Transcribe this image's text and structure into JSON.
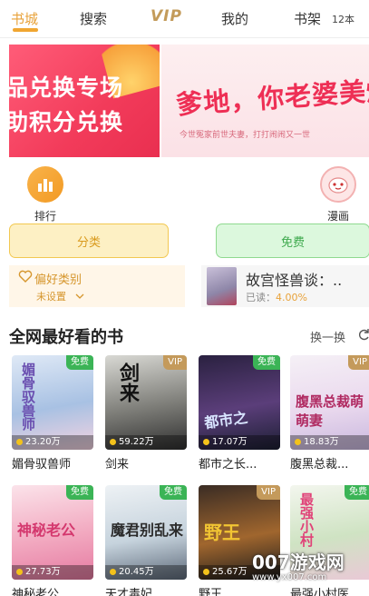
{
  "tabs": [
    {
      "label": "书城"
    },
    {
      "label": "搜索"
    },
    {
      "label": "VIP"
    },
    {
      "label": "我的"
    },
    {
      "label": "书架"
    }
  ],
  "shelf_count": "12本",
  "banner": {
    "left_line1": "品兑换专场",
    "left_line2": "助积分兑换",
    "right_headline": "爹地，你老婆美爆了",
    "right_sub": "今世冤家前世夫妻，打打闹闹又一世"
  },
  "quick_icons": [
    {
      "label": "排行",
      "icon": "bar-chart-icon"
    },
    {
      "label": "漫画",
      "icon": "comic-face-icon"
    }
  ],
  "category_buttons": {
    "left": "分类",
    "right": "免费"
  },
  "preference": {
    "title": "偏好类别",
    "value": "未设置"
  },
  "recent_reading": {
    "title": "故宫怪兽谈：..",
    "progress_label": "已读：",
    "progress": "4.00%"
  },
  "section": {
    "title": "全网最好看的书",
    "swap_label": "换一换"
  },
  "books": [
    {
      "name": "媚骨驭兽师",
      "views": "23.20万",
      "badge": "免费",
      "cover_text": "媚骨驭兽师",
      "colors": [
        "#dfe9f6",
        "#a8c1e3",
        "#f3d3e0"
      ]
    },
    {
      "name": "剑来",
      "views": "59.22万",
      "badge": "VIP",
      "cover_text": "剑来",
      "colors": [
        "#d9d9d4",
        "#7d7d78",
        "#2f2f2f"
      ]
    },
    {
      "name": "都市之长...",
      "views": "17.07万",
      "badge": "免费",
      "cover_text": "都市之",
      "colors": [
        "#2a2140",
        "#5b3e7a",
        "#1c1f33"
      ]
    },
    {
      "name": "腹黑总裁...",
      "views": "18.83万",
      "badge": "VIP",
      "cover_text": "腹黑总裁萌萌妻",
      "colors": [
        "#f5f0f6",
        "#ead9ee",
        "#c9b8de"
      ]
    },
    {
      "name": "神秘老公...",
      "views": "27.73万",
      "badge": "免费",
      "cover_text": "神秘老公",
      "colors": [
        "#fbe3ea",
        "#f2a9c0",
        "#e57aa1"
      ]
    },
    {
      "name": "天才毒妃...",
      "views": "20.45万",
      "badge": "免费",
      "cover_text": "魔君别乱来",
      "colors": [
        "#eef2f5",
        "#c6d3dd",
        "#5e6a7a"
      ]
    },
    {
      "name": "野王",
      "views": "25.67万",
      "badge": "VIP",
      "cover_text": "野王",
      "colors": [
        "#3a2c24",
        "#a0662e",
        "#1b1b1b"
      ]
    },
    {
      "name": "最强小村医",
      "views": "",
      "badge": "免费",
      "cover_text": "最强小村",
      "colors": [
        "#f3f6ee",
        "#cfe3c3",
        "#e9c9d6"
      ]
    }
  ],
  "watermark": {
    "line1": "007游戏网",
    "line2": "www.yx007.com"
  },
  "colors": {
    "accent": "#e8a23a",
    "free_badge": "#3bb456",
    "vip_badge": "#c49a5b"
  }
}
